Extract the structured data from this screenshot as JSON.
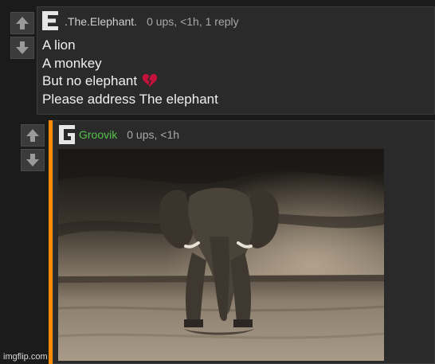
{
  "comment1": {
    "avatar_letter": "E",
    "username": ".The.Elephant.",
    "stats": "0 ups, <1h, 1 reply",
    "lines": [
      "A lion",
      "A monkey",
      "But no elephant",
      "Please address The elephant"
    ],
    "heart_icon": "broken-heart"
  },
  "comment2": {
    "avatar_letter": "G",
    "username": "Groovik",
    "stats": "0 ups, <1h",
    "image_alt": "elephant"
  },
  "footer": {
    "watermark": "imgflip.com"
  },
  "colors": {
    "accent": "#ff8c00",
    "username_green": "#55c04a",
    "background": "#1b1b1b"
  }
}
